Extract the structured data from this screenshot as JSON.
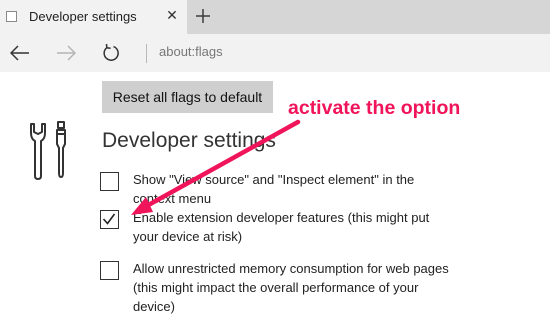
{
  "browser": {
    "tab": {
      "title": "Developer settings",
      "close_glyph": "✕"
    },
    "address": "about:flags",
    "icons": [
      "back-arrow-icon",
      "forward-arrow-icon",
      "refresh-icon",
      "new-tab-plus-icon",
      "close-icon",
      "tools-icon",
      "checkmark-icon"
    ]
  },
  "page": {
    "reset_button": "Reset all flags to default",
    "section_title": "Developer settings",
    "options": [
      {
        "label": "Show \"View source\" and \"Inspect element\" in the context menu",
        "checked": false
      },
      {
        "label": "Enable extension developer features (this might put your device at risk)",
        "checked": true
      },
      {
        "label": "Allow unrestricted memory consumption for web pages (this might impact the overall performance of your device)",
        "checked": false
      }
    ]
  },
  "annotation": {
    "text": "activate the option",
    "color": "#f0145a"
  }
}
